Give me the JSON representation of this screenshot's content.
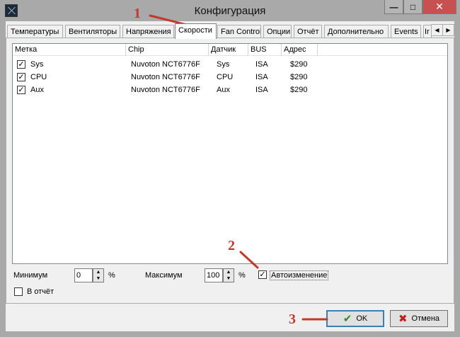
{
  "window": {
    "title": "Конфигурация",
    "min_glyph": "—",
    "max_glyph": "□",
    "close_glyph": "✕"
  },
  "tabs": [
    {
      "label": "Температуры"
    },
    {
      "label": "Вентиляторы"
    },
    {
      "label": "Напряжения"
    },
    {
      "label": "Скорости",
      "active": true
    },
    {
      "label": "Fan Control"
    },
    {
      "label": "Опции"
    },
    {
      "label": "Отчёт"
    },
    {
      "label": "Дополнительно"
    },
    {
      "label": "Events"
    },
    {
      "label": "Ir"
    }
  ],
  "tab_scroll": {
    "left": "◀",
    "right": "▶"
  },
  "list": {
    "columns": [
      "Метка",
      "Chip",
      "Датчик",
      "BUS",
      "Адрес"
    ],
    "rows": [
      {
        "checked": true,
        "label": "Sys",
        "chip": "Nuvoton NCT6776F",
        "sensor": "Sys",
        "bus": "ISA",
        "address": "$290"
      },
      {
        "checked": true,
        "label": "CPU",
        "chip": "Nuvoton NCT6776F",
        "sensor": "CPU",
        "bus": "ISA",
        "address": "$290"
      },
      {
        "checked": true,
        "label": "Aux",
        "chip": "Nuvoton NCT6776F",
        "sensor": "Aux",
        "bus": "ISA",
        "address": "$290"
      }
    ]
  },
  "controls": {
    "min_label": "Минимум",
    "min_value": "0",
    "min_unit": "%",
    "max_label": "Максимум",
    "max_value": "100",
    "max_unit": "%",
    "auto_label": "Автоизменение",
    "auto_checked": true,
    "report_label": "В отчёт",
    "report_checked": false
  },
  "buttons": {
    "ok": "OK",
    "cancel": "Отмена"
  },
  "annotations": [
    "1",
    "2",
    "3"
  ],
  "colors": {
    "annotation": "#c0392b"
  }
}
